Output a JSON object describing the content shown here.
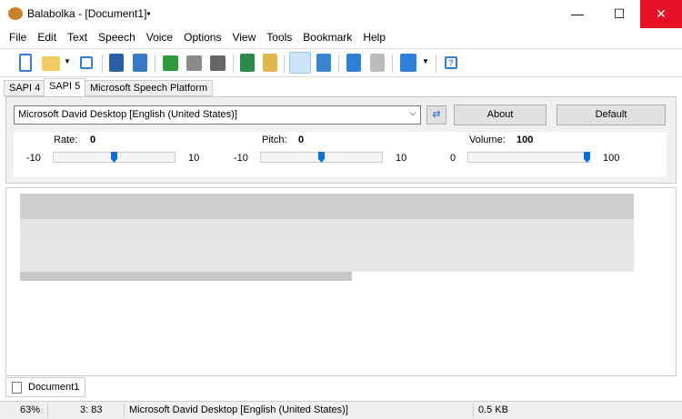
{
  "window": {
    "title": "Balabolka - [Document1]•",
    "minimize": "—",
    "maximize": "☐",
    "close": "✕"
  },
  "menu": [
    "File",
    "Edit",
    "Text",
    "Speech",
    "Voice",
    "Options",
    "View",
    "Tools",
    "Bookmark",
    "Help"
  ],
  "toolbar_icons": [
    "new-icon",
    "open-icon",
    "open-dropdown-icon",
    "save-icon",
    "save-audio-icon",
    "save-audio-split-icon",
    "play-icon",
    "pause-icon",
    "stop-icon",
    "play-clipboard-icon",
    "play-file-icon",
    "read-clipboard-icon",
    "spell-icon",
    "bookmark-add-icon",
    "bookmark-icon",
    "voice-dropdown-icon",
    "help-icon"
  ],
  "tabs": [
    "SAPI 4",
    "SAPI 5",
    "Microsoft Speech Platform"
  ],
  "voice": {
    "selected": "Microsoft David Desktop [English (United States)]",
    "about": "About",
    "default": "Default"
  },
  "rate": {
    "label": "Rate:",
    "value": "0",
    "min": "-10",
    "max": "10",
    "fraction": 0.5
  },
  "pitch": {
    "label": "Pitch:",
    "value": "0",
    "min": "-10",
    "max": "10",
    "fraction": 0.5
  },
  "volume": {
    "label": "Volume:",
    "value": "100",
    "min": "0",
    "max": "100",
    "fraction": 1.0
  },
  "document_tab": "Document1",
  "status": {
    "zoom": "63%",
    "position": "3: 83",
    "voice": "Microsoft David Desktop [English (United States)]",
    "size": "0.5 KB"
  },
  "colors": {
    "accent": "#0a6fd6",
    "close_hover": "#e81123"
  }
}
